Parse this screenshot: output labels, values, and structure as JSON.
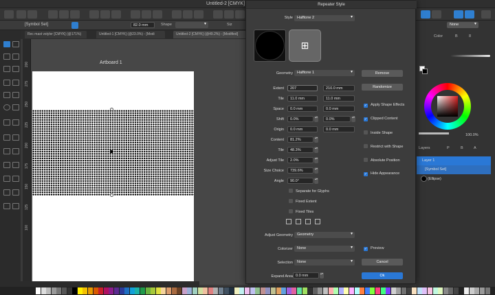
{
  "window": {
    "title": "Untitled-2 [CMYK]"
  },
  "context_bar": {
    "selection": "[Symbol Set]",
    "rotation_value": "82.0 mm",
    "shape_label": "Shape",
    "size_label": "Siz"
  },
  "doc_tabs": [
    "Rec mast vstyler [CMYK] (@171%)",
    "Untitled-1 [CMYK] (@23.0%) - [Modi",
    "Untitled-2 [CMYK] (@49.2%) - [Modified]"
  ],
  "ruler": {
    "marks": [
      "200",
      "275",
      "250",
      "225",
      "200",
      "175",
      "150",
      "125",
      "100"
    ]
  },
  "canvas": {
    "artboard_label": "Artboard 1"
  },
  "dialog": {
    "title": "Repeater Style",
    "style_label": "Style",
    "style_value": "Halftone 2",
    "geometry_label": "Geometry",
    "geometry_value": "Halftone 1",
    "remove_label": "Remove",
    "randomize_label": "Randomize",
    "rows": [
      {
        "label": "Extent",
        "v1": "207",
        "v2": "210.0 mm"
      },
      {
        "label": "Tile",
        "v1": "11.0 mm",
        "v2": "11.0 mm"
      },
      {
        "label": "Space",
        "v1": "0.0 mm",
        "v2": "0.0 mm"
      },
      {
        "label": "Shift",
        "v1": "0.0%",
        "v2": "0.0%"
      },
      {
        "label": "Origin",
        "v1": "0.0 mm",
        "v2": "0.0 mm"
      }
    ],
    "rows2": [
      {
        "label": "Content",
        "v1": "81.2%"
      },
      {
        "label": "Tile",
        "v1": "48.3%"
      },
      {
        "label": "Adjust Tile",
        "v1": "2.0%"
      },
      {
        "label": "Size Choice",
        "v1": "739.6%"
      },
      {
        "label": "Angle",
        "v1": "90.0°"
      }
    ],
    "checks_right": [
      {
        "label": "Apply Shape Effects",
        "checked": true
      },
      {
        "label": "Clipped Content",
        "checked": true
      },
      {
        "label": "Inside Shape",
        "checked": false
      },
      {
        "label": "Restrict with Shape",
        "checked": false
      },
      {
        "label": "Absolute Position",
        "checked": false
      },
      {
        "label": "Hide Appearance",
        "checked": true
      }
    ],
    "checks_left": [
      {
        "label": "Separate for Glyphs",
        "checked": false
      },
      {
        "label": "Fixed Extent",
        "checked": false
      },
      {
        "label": "Fixed Tiles",
        "checked": false
      }
    ],
    "adjust_geometry_label": "Adjust Geometry",
    "adjust_geometry_value": "Geometry",
    "colorizer_label": "Colorizer",
    "colorizer_value": "None",
    "selection_label": "Selection",
    "selection_value": "None",
    "expand_area_label": "Expand Area",
    "expand_area_value": "0.0 mm",
    "preview_label": "Preview",
    "cancel_label": "Cancel",
    "ok_label": "Ok"
  },
  "right_panel": {
    "tabs": [
      "Color",
      "B",
      "8"
    ],
    "opacity_value": "100.0%",
    "fill_value": "None",
    "layer_tabs": [
      "Layers",
      "P",
      "B",
      "A"
    ],
    "layers": [
      "Layer 1",
      "[Symbol Set]",
      "(Ellipse)"
    ]
  }
}
